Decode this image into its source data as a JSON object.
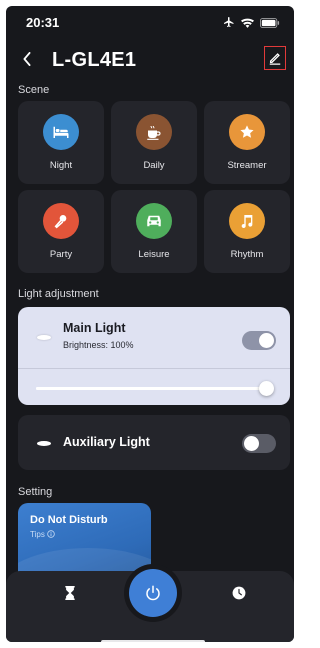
{
  "status_bar": {
    "time": "20:31"
  },
  "header": {
    "title": "L-GL4E1"
  },
  "scene": {
    "label": "Scene",
    "items": [
      {
        "name": "Night",
        "icon": "bed-icon",
        "color": "#3c8ed1"
      },
      {
        "name": "Daily",
        "icon": "coffee-icon",
        "color": "#8a5432"
      },
      {
        "name": "Streamer",
        "icon": "star-icon",
        "color": "#e8963a"
      },
      {
        "name": "Party",
        "icon": "microphone-icon",
        "color": "#e2553a"
      },
      {
        "name": "Leisure",
        "icon": "car-icon",
        "color": "#4fae5c"
      },
      {
        "name": "Rhythm",
        "icon": "music-note-icon",
        "color": "#eaa035"
      }
    ]
  },
  "light_adjustment": {
    "label": "Light adjustment",
    "main_light": {
      "name": "Main Light",
      "brightness_text": "Brightness: 100%",
      "brightness": 100,
      "on": true
    },
    "auxiliary_light": {
      "name": "Auxiliary Light",
      "on": false
    }
  },
  "setting": {
    "label": "Setting",
    "do_not_disturb": {
      "title": "Do Not Disturb",
      "tips": "Tips"
    }
  },
  "bottom_nav": {
    "left_icon": "hourglass-icon",
    "center_icon": "power-icon",
    "right_icon": "clock-icon"
  },
  "colors": {
    "accent": "#3f7fd6",
    "background": "#17181c",
    "card": "#24252b"
  }
}
